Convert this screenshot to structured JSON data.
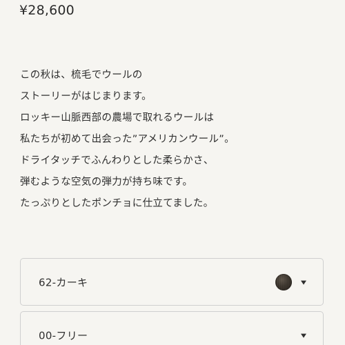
{
  "product": {
    "price": "¥28,600"
  },
  "description": {
    "lines": [
      "この秋は、梳毛でウールの",
      "ストーリーがはじまります。",
      "ロッキー山脈西部の農場で取れるウールは",
      "私たちが初めて出会った”アメリカンウール”。",
      "ドライタッチでふんわりとした柔らかさ、",
      "弾むような空気の弾力が持ち味です。",
      "たっぷりとしたポンチョに仕立てました。"
    ]
  },
  "color_select": {
    "value": "62-カーキ",
    "swatch_color": "#3a332b",
    "icon": "chevron-down-icon"
  },
  "size_select": {
    "value": "00-フリー",
    "icon": "chevron-down-icon"
  }
}
